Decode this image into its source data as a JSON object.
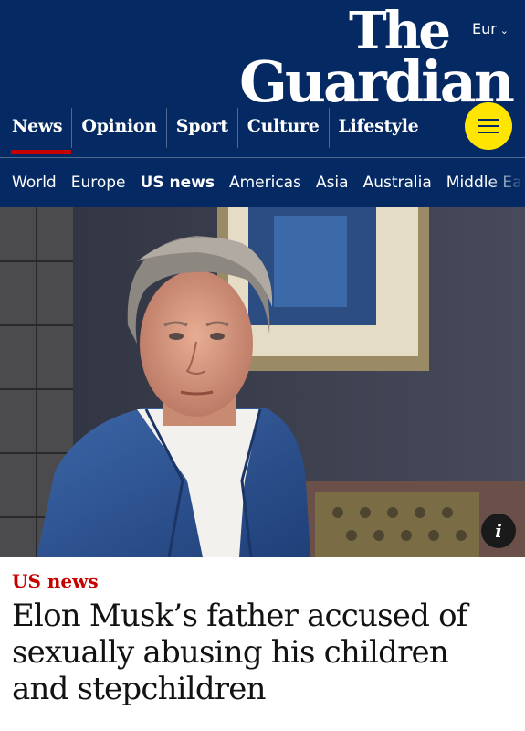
{
  "header": {
    "edition_label": "Eur",
    "logo_line1": "The",
    "logo_line2": "Guardian",
    "pillars": [
      {
        "label": "News"
      },
      {
        "label": "Opinion"
      },
      {
        "label": "Sport"
      },
      {
        "label": "Culture"
      },
      {
        "label": "Lifestyle"
      }
    ],
    "active_pillar": "News",
    "menu_icon": "hamburger-icon",
    "subnav": [
      {
        "label": "World"
      },
      {
        "label": "Europe"
      },
      {
        "label": "US news"
      },
      {
        "label": "Americas"
      },
      {
        "label": "Asia"
      },
      {
        "label": "Australia"
      },
      {
        "label": "Middle East"
      }
    ],
    "active_subnav": "US news"
  },
  "colors": {
    "brand_blue": "#052962",
    "news_red": "#c70000",
    "menu_yellow": "#ffe500"
  },
  "photo": {
    "info_icon_label": "i"
  },
  "article": {
    "kicker": "US news",
    "headline": "Elon Musk’s father accused of sexually abusing his children and stepchildren"
  }
}
